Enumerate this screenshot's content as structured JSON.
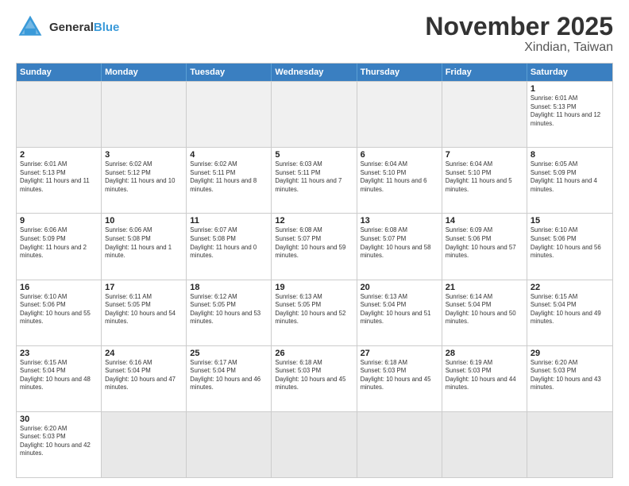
{
  "header": {
    "logo_general": "General",
    "logo_blue": "Blue",
    "month_title": "November 2025",
    "location": "Xindian, Taiwan"
  },
  "day_headers": [
    "Sunday",
    "Monday",
    "Tuesday",
    "Wednesday",
    "Thursday",
    "Friday",
    "Saturday"
  ],
  "weeks": [
    [
      {
        "day": "",
        "empty": true
      },
      {
        "day": "",
        "empty": true
      },
      {
        "day": "",
        "empty": true
      },
      {
        "day": "",
        "empty": true
      },
      {
        "day": "",
        "empty": true
      },
      {
        "day": "",
        "empty": true
      },
      {
        "day": "1",
        "sunrise": "6:01 AM",
        "sunset": "5:13 PM",
        "daylight": "11 hours and 12 minutes."
      }
    ],
    [
      {
        "day": "2",
        "sunrise": "6:01 AM",
        "sunset": "5:13 PM",
        "daylight": "11 hours and 11 minutes."
      },
      {
        "day": "3",
        "sunrise": "6:02 AM",
        "sunset": "5:12 PM",
        "daylight": "11 hours and 10 minutes."
      },
      {
        "day": "4",
        "sunrise": "6:02 AM",
        "sunset": "5:11 PM",
        "daylight": "11 hours and 8 minutes."
      },
      {
        "day": "5",
        "sunrise": "6:03 AM",
        "sunset": "5:11 PM",
        "daylight": "11 hours and 7 minutes."
      },
      {
        "day": "6",
        "sunrise": "6:04 AM",
        "sunset": "5:10 PM",
        "daylight": "11 hours and 6 minutes."
      },
      {
        "day": "7",
        "sunrise": "6:04 AM",
        "sunset": "5:10 PM",
        "daylight": "11 hours and 5 minutes."
      },
      {
        "day": "8",
        "sunrise": "6:05 AM",
        "sunset": "5:09 PM",
        "daylight": "11 hours and 4 minutes."
      }
    ],
    [
      {
        "day": "9",
        "sunrise": "6:06 AM",
        "sunset": "5:09 PM",
        "daylight": "11 hours and 2 minutes."
      },
      {
        "day": "10",
        "sunrise": "6:06 AM",
        "sunset": "5:08 PM",
        "daylight": "11 hours and 1 minute."
      },
      {
        "day": "11",
        "sunrise": "6:07 AM",
        "sunset": "5:08 PM",
        "daylight": "11 hours and 0 minutes."
      },
      {
        "day": "12",
        "sunrise": "6:08 AM",
        "sunset": "5:07 PM",
        "daylight": "10 hours and 59 minutes."
      },
      {
        "day": "13",
        "sunrise": "6:08 AM",
        "sunset": "5:07 PM",
        "daylight": "10 hours and 58 minutes."
      },
      {
        "day": "14",
        "sunrise": "6:09 AM",
        "sunset": "5:06 PM",
        "daylight": "10 hours and 57 minutes."
      },
      {
        "day": "15",
        "sunrise": "6:10 AM",
        "sunset": "5:06 PM",
        "daylight": "10 hours and 56 minutes."
      }
    ],
    [
      {
        "day": "16",
        "sunrise": "6:10 AM",
        "sunset": "5:06 PM",
        "daylight": "10 hours and 55 minutes."
      },
      {
        "day": "17",
        "sunrise": "6:11 AM",
        "sunset": "5:05 PM",
        "daylight": "10 hours and 54 minutes."
      },
      {
        "day": "18",
        "sunrise": "6:12 AM",
        "sunset": "5:05 PM",
        "daylight": "10 hours and 53 minutes."
      },
      {
        "day": "19",
        "sunrise": "6:13 AM",
        "sunset": "5:05 PM",
        "daylight": "10 hours and 52 minutes."
      },
      {
        "day": "20",
        "sunrise": "6:13 AM",
        "sunset": "5:04 PM",
        "daylight": "10 hours and 51 minutes."
      },
      {
        "day": "21",
        "sunrise": "6:14 AM",
        "sunset": "5:04 PM",
        "daylight": "10 hours and 50 minutes."
      },
      {
        "day": "22",
        "sunrise": "6:15 AM",
        "sunset": "5:04 PM",
        "daylight": "10 hours and 49 minutes."
      }
    ],
    [
      {
        "day": "23",
        "sunrise": "6:15 AM",
        "sunset": "5:04 PM",
        "daylight": "10 hours and 48 minutes."
      },
      {
        "day": "24",
        "sunrise": "6:16 AM",
        "sunset": "5:04 PM",
        "daylight": "10 hours and 47 minutes."
      },
      {
        "day": "25",
        "sunrise": "6:17 AM",
        "sunset": "5:04 PM",
        "daylight": "10 hours and 46 minutes."
      },
      {
        "day": "26",
        "sunrise": "6:18 AM",
        "sunset": "5:03 PM",
        "daylight": "10 hours and 45 minutes."
      },
      {
        "day": "27",
        "sunrise": "6:18 AM",
        "sunset": "5:03 PM",
        "daylight": "10 hours and 45 minutes."
      },
      {
        "day": "28",
        "sunrise": "6:19 AM",
        "sunset": "5:03 PM",
        "daylight": "10 hours and 44 minutes."
      },
      {
        "day": "29",
        "sunrise": "6:20 AM",
        "sunset": "5:03 PM",
        "daylight": "10 hours and 43 minutes."
      }
    ],
    [
      {
        "day": "30",
        "sunrise": "6:20 AM",
        "sunset": "5:03 PM",
        "daylight": "10 hours and 42 minutes."
      },
      {
        "day": "",
        "empty": true
      },
      {
        "day": "",
        "empty": true
      },
      {
        "day": "",
        "empty": true
      },
      {
        "day": "",
        "empty": true
      },
      {
        "day": "",
        "empty": true
      },
      {
        "day": "",
        "empty": true
      }
    ]
  ],
  "labels": {
    "sunrise": "Sunrise:",
    "sunset": "Sunset:",
    "daylight": "Daylight:"
  }
}
